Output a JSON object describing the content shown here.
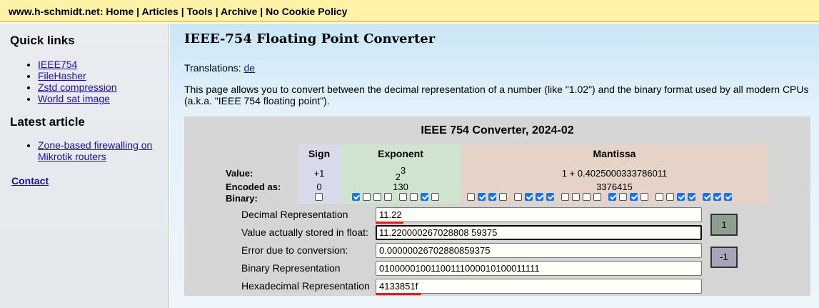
{
  "topbar": {
    "site": "www.h-schmidt.net",
    "links": [
      "Home",
      "Articles",
      "Tools",
      "Archive",
      "No Cookie Policy"
    ]
  },
  "sidebar": {
    "quick_links_title": "Quick links",
    "quick_links": [
      "IEEE754",
      "FileHasher",
      "Zstd compression",
      "World sat image"
    ],
    "latest_title": "Latest article",
    "latest_link": "Zone-based firewalling on Mikrotik routers",
    "contact": "Contact"
  },
  "page": {
    "title": "IEEE-754 Floating Point Converter",
    "translations_label": "Translations:",
    "translations_link": "de",
    "intro": "This page allows you to convert between the decimal representation of a number (like \"1.02\") and the binary format used by all modern CPUs (a.k.a. \"IEEE 754 floating point\")."
  },
  "converter": {
    "title": "IEEE 754 Converter, 2024-02",
    "headers": {
      "sign": "Sign",
      "exponent": "Exponent",
      "mantissa": "Mantissa"
    },
    "row_labels": {
      "value": "Value:",
      "encoded": "Encoded as:",
      "binary": "Binary:"
    },
    "sign": {
      "value": "+1",
      "encoded": "0"
    },
    "exponent": {
      "base": "2",
      "power": "3",
      "encoded": "130"
    },
    "mantissa": {
      "value": "1 + 0.4025000333786011",
      "encoded": "3376415"
    },
    "bits": "01000001001100111000010100011111",
    "fields": [
      {
        "label": "Decimal Representation",
        "value": "11.22"
      },
      {
        "label": "Value actually stored in float:",
        "value": "11.220000267028808 59375"
      },
      {
        "label": "Error due to conversion:",
        "value": "0.00000026702880859375"
      },
      {
        "label": "Binary Representation",
        "value": "01000001001100111000010100011111"
      },
      {
        "label": "Hexadecimal Representation",
        "value": "4133851f"
      }
    ],
    "buttons": {
      "plus": "1",
      "minus": "-1"
    },
    "colors": {
      "plus_btn": "#8f9f8f",
      "minus_btn": "#a7a3b9",
      "highlight": "#e0201f"
    }
  }
}
